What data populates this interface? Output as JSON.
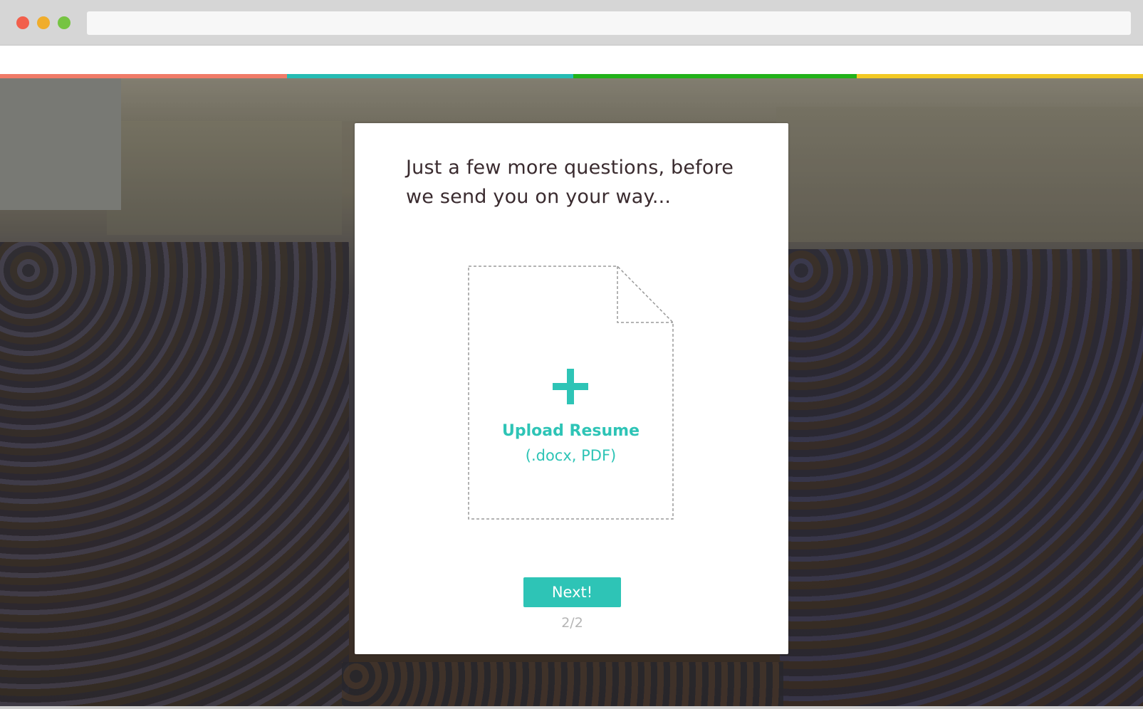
{
  "colors": {
    "accent": "#2ec4b6",
    "heading_text": "#3a2b2f",
    "pager_text": "#b5b5b5",
    "stripe": [
      "#f07b68",
      "#26bcb4",
      "#22b21a",
      "#f2c924"
    ]
  },
  "modal": {
    "heading": "Just a few more questions, before we send you on your way...",
    "upload": {
      "icon": "plus-icon",
      "title": "Upload Resume",
      "formats": "(.docx, PDF)"
    },
    "next_label": "Next!",
    "pager": "2/2"
  }
}
